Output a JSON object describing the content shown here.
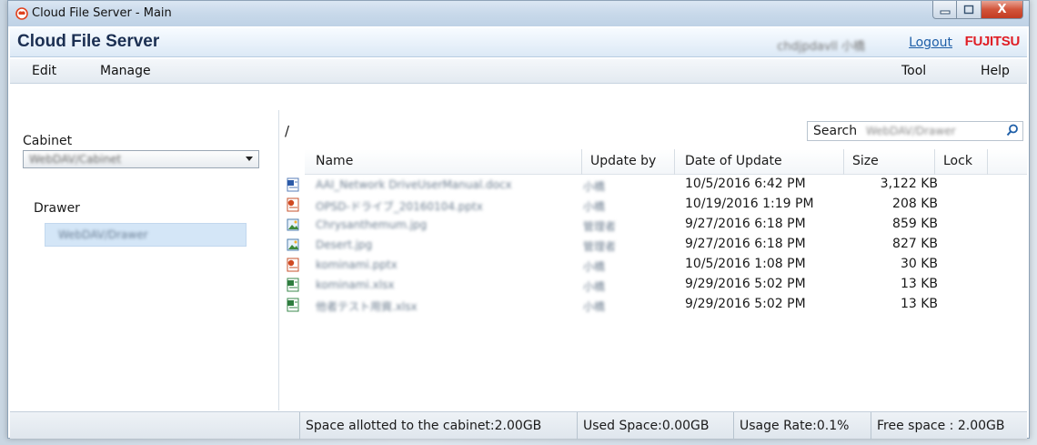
{
  "window": {
    "title": "Cloud File Server - Main",
    "controls": {
      "minimize": "–",
      "maximize": "□",
      "close": "X"
    }
  },
  "header": {
    "brand": "Cloud File Server",
    "user_name": "chdjpdavll 小橋",
    "logout": "Logout",
    "vendor_logo": "FUJITSU"
  },
  "menu": {
    "left": [
      "Edit",
      "Manage"
    ],
    "right": [
      "Tool",
      "Help"
    ]
  },
  "sidebar": {
    "cabinet_label": "Cabinet",
    "cabinet_value": "WebDAV/Cabinet",
    "drawer_label": "Drawer",
    "drawer_item": "WebDAV/Drawer"
  },
  "main": {
    "path": "/",
    "search_label": "Search",
    "search_scope": "WebDAV/Drawer",
    "columns": [
      "Name",
      "Update by",
      "Date of Update",
      "Size",
      "Lock"
    ],
    "rows": [
      {
        "icon": "word-doc-icon",
        "name": "AAI_Network DriveUserManual.docx",
        "update_by": "小橋",
        "date": "10/5/2016 6:42 PM",
        "size": "3,122 KB",
        "lock": ""
      },
      {
        "icon": "powerpoint-icon",
        "name": "OPSD-ドライブ_20160104.pptx",
        "update_by": "小橋",
        "date": "10/19/2016 1:19 PM",
        "size": "208 KB",
        "lock": ""
      },
      {
        "icon": "image-icon",
        "name": "Chrysanthemum.jpg",
        "update_by": "管理者",
        "date": "9/27/2016 6:18 PM",
        "size": "859 KB",
        "lock": ""
      },
      {
        "icon": "image-icon",
        "name": "Desert.jpg",
        "update_by": "管理者",
        "date": "9/27/2016 6:18 PM",
        "size": "827 KB",
        "lock": ""
      },
      {
        "icon": "powerpoint-icon",
        "name": "kominami.pptx",
        "update_by": "小橋",
        "date": "10/5/2016 1:08 PM",
        "size": "30 KB",
        "lock": ""
      },
      {
        "icon": "excel-icon",
        "name": "kominami.xlsx",
        "update_by": "小橋",
        "date": "9/29/2016 5:02 PM",
        "size": "13 KB",
        "lock": ""
      },
      {
        "icon": "excel-icon",
        "name": "他者テスト用資.xlsx",
        "update_by": "小橋",
        "date": "9/29/2016 5:02 PM",
        "size": "13 KB",
        "lock": ""
      }
    ]
  },
  "status": {
    "allotted": "Space allotted to the cabinet:2.00GB",
    "used": "Used Space:0.00GB",
    "usage_rate": "Usage Rate:0.1%",
    "free": "Free space : 2.00GB"
  },
  "colors": {
    "accent": "#1f5fa8",
    "brand_text": "#1b2f52",
    "vendor": "#e01e25",
    "selection": "#d4e6f7"
  }
}
